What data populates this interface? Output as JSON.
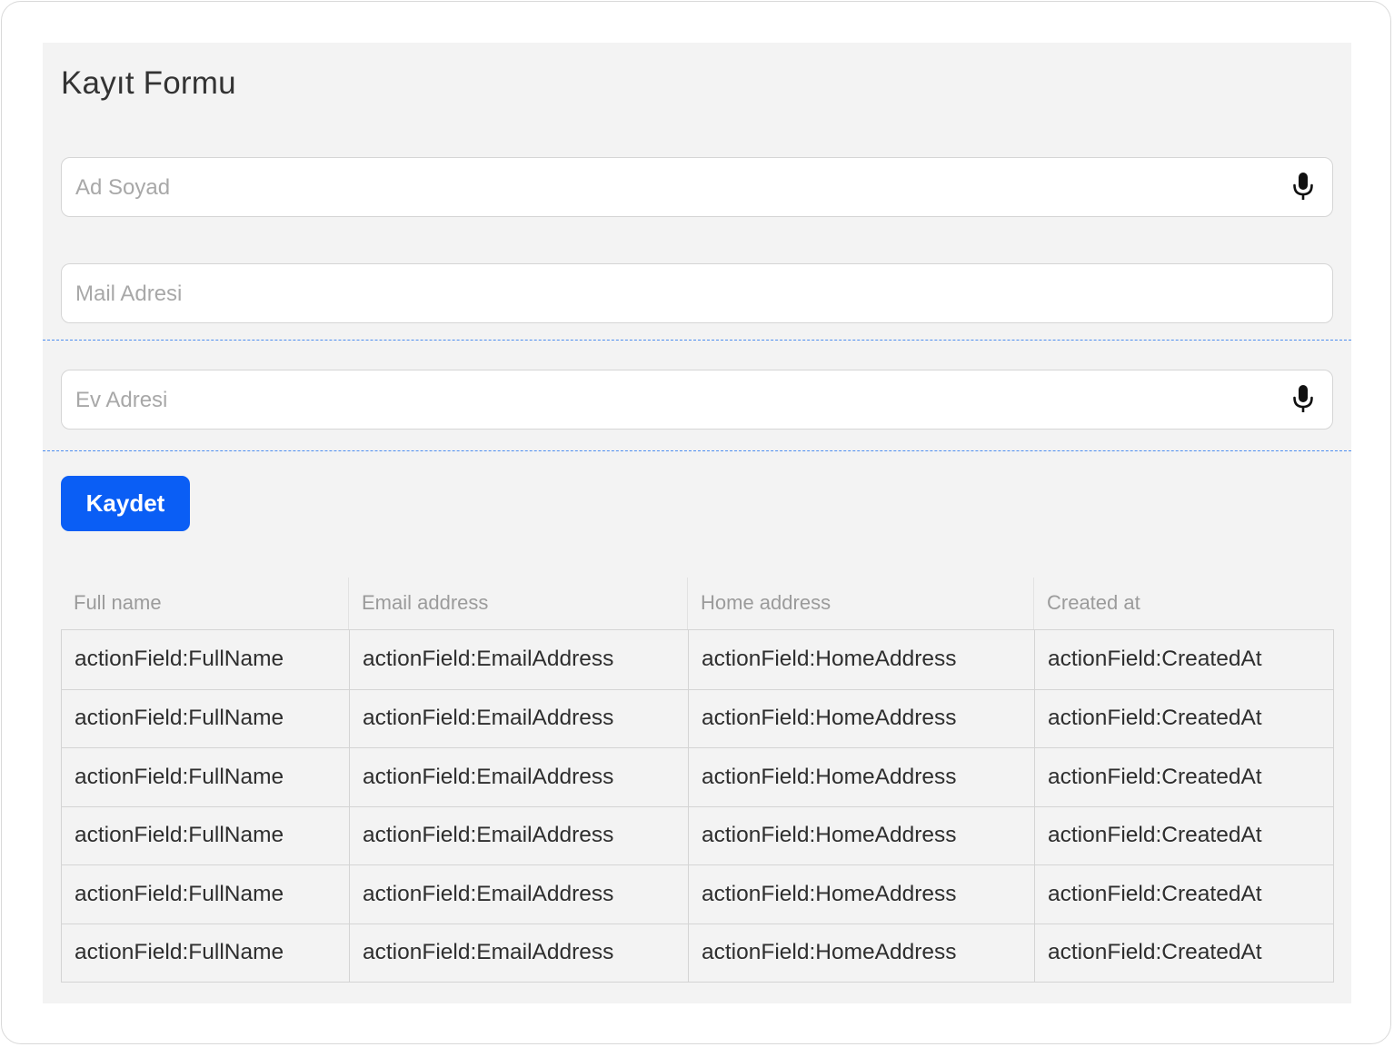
{
  "form": {
    "title": "Kayıt Formu",
    "full_name_placeholder": "Ad Soyad",
    "email_placeholder": "Mail Adresi",
    "home_address_placeholder": "Ev Adresi",
    "mic_icon": "microphone-icon",
    "save_label": "Kaydet",
    "accent_color": "#0a5ef5"
  },
  "table": {
    "headers": [
      "Full name",
      "Email address",
      "Home address",
      "Created at"
    ],
    "rows": [
      [
        "actionField:FullName",
        "actionField:EmailAddress",
        "actionField:HomeAddress",
        "actionField:CreatedAt"
      ],
      [
        "actionField:FullName",
        "actionField:EmailAddress",
        "actionField:HomeAddress",
        "actionField:CreatedAt"
      ],
      [
        "actionField:FullName",
        "actionField:EmailAddress",
        "actionField:HomeAddress",
        "actionField:CreatedAt"
      ],
      [
        "actionField:FullName",
        "actionField:EmailAddress",
        "actionField:HomeAddress",
        "actionField:CreatedAt"
      ],
      [
        "actionField:FullName",
        "actionField:EmailAddress",
        "actionField:HomeAddress",
        "actionField:CreatedAt"
      ],
      [
        "actionField:FullName",
        "actionField:EmailAddress",
        "actionField:HomeAddress",
        "actionField:CreatedAt"
      ]
    ]
  }
}
